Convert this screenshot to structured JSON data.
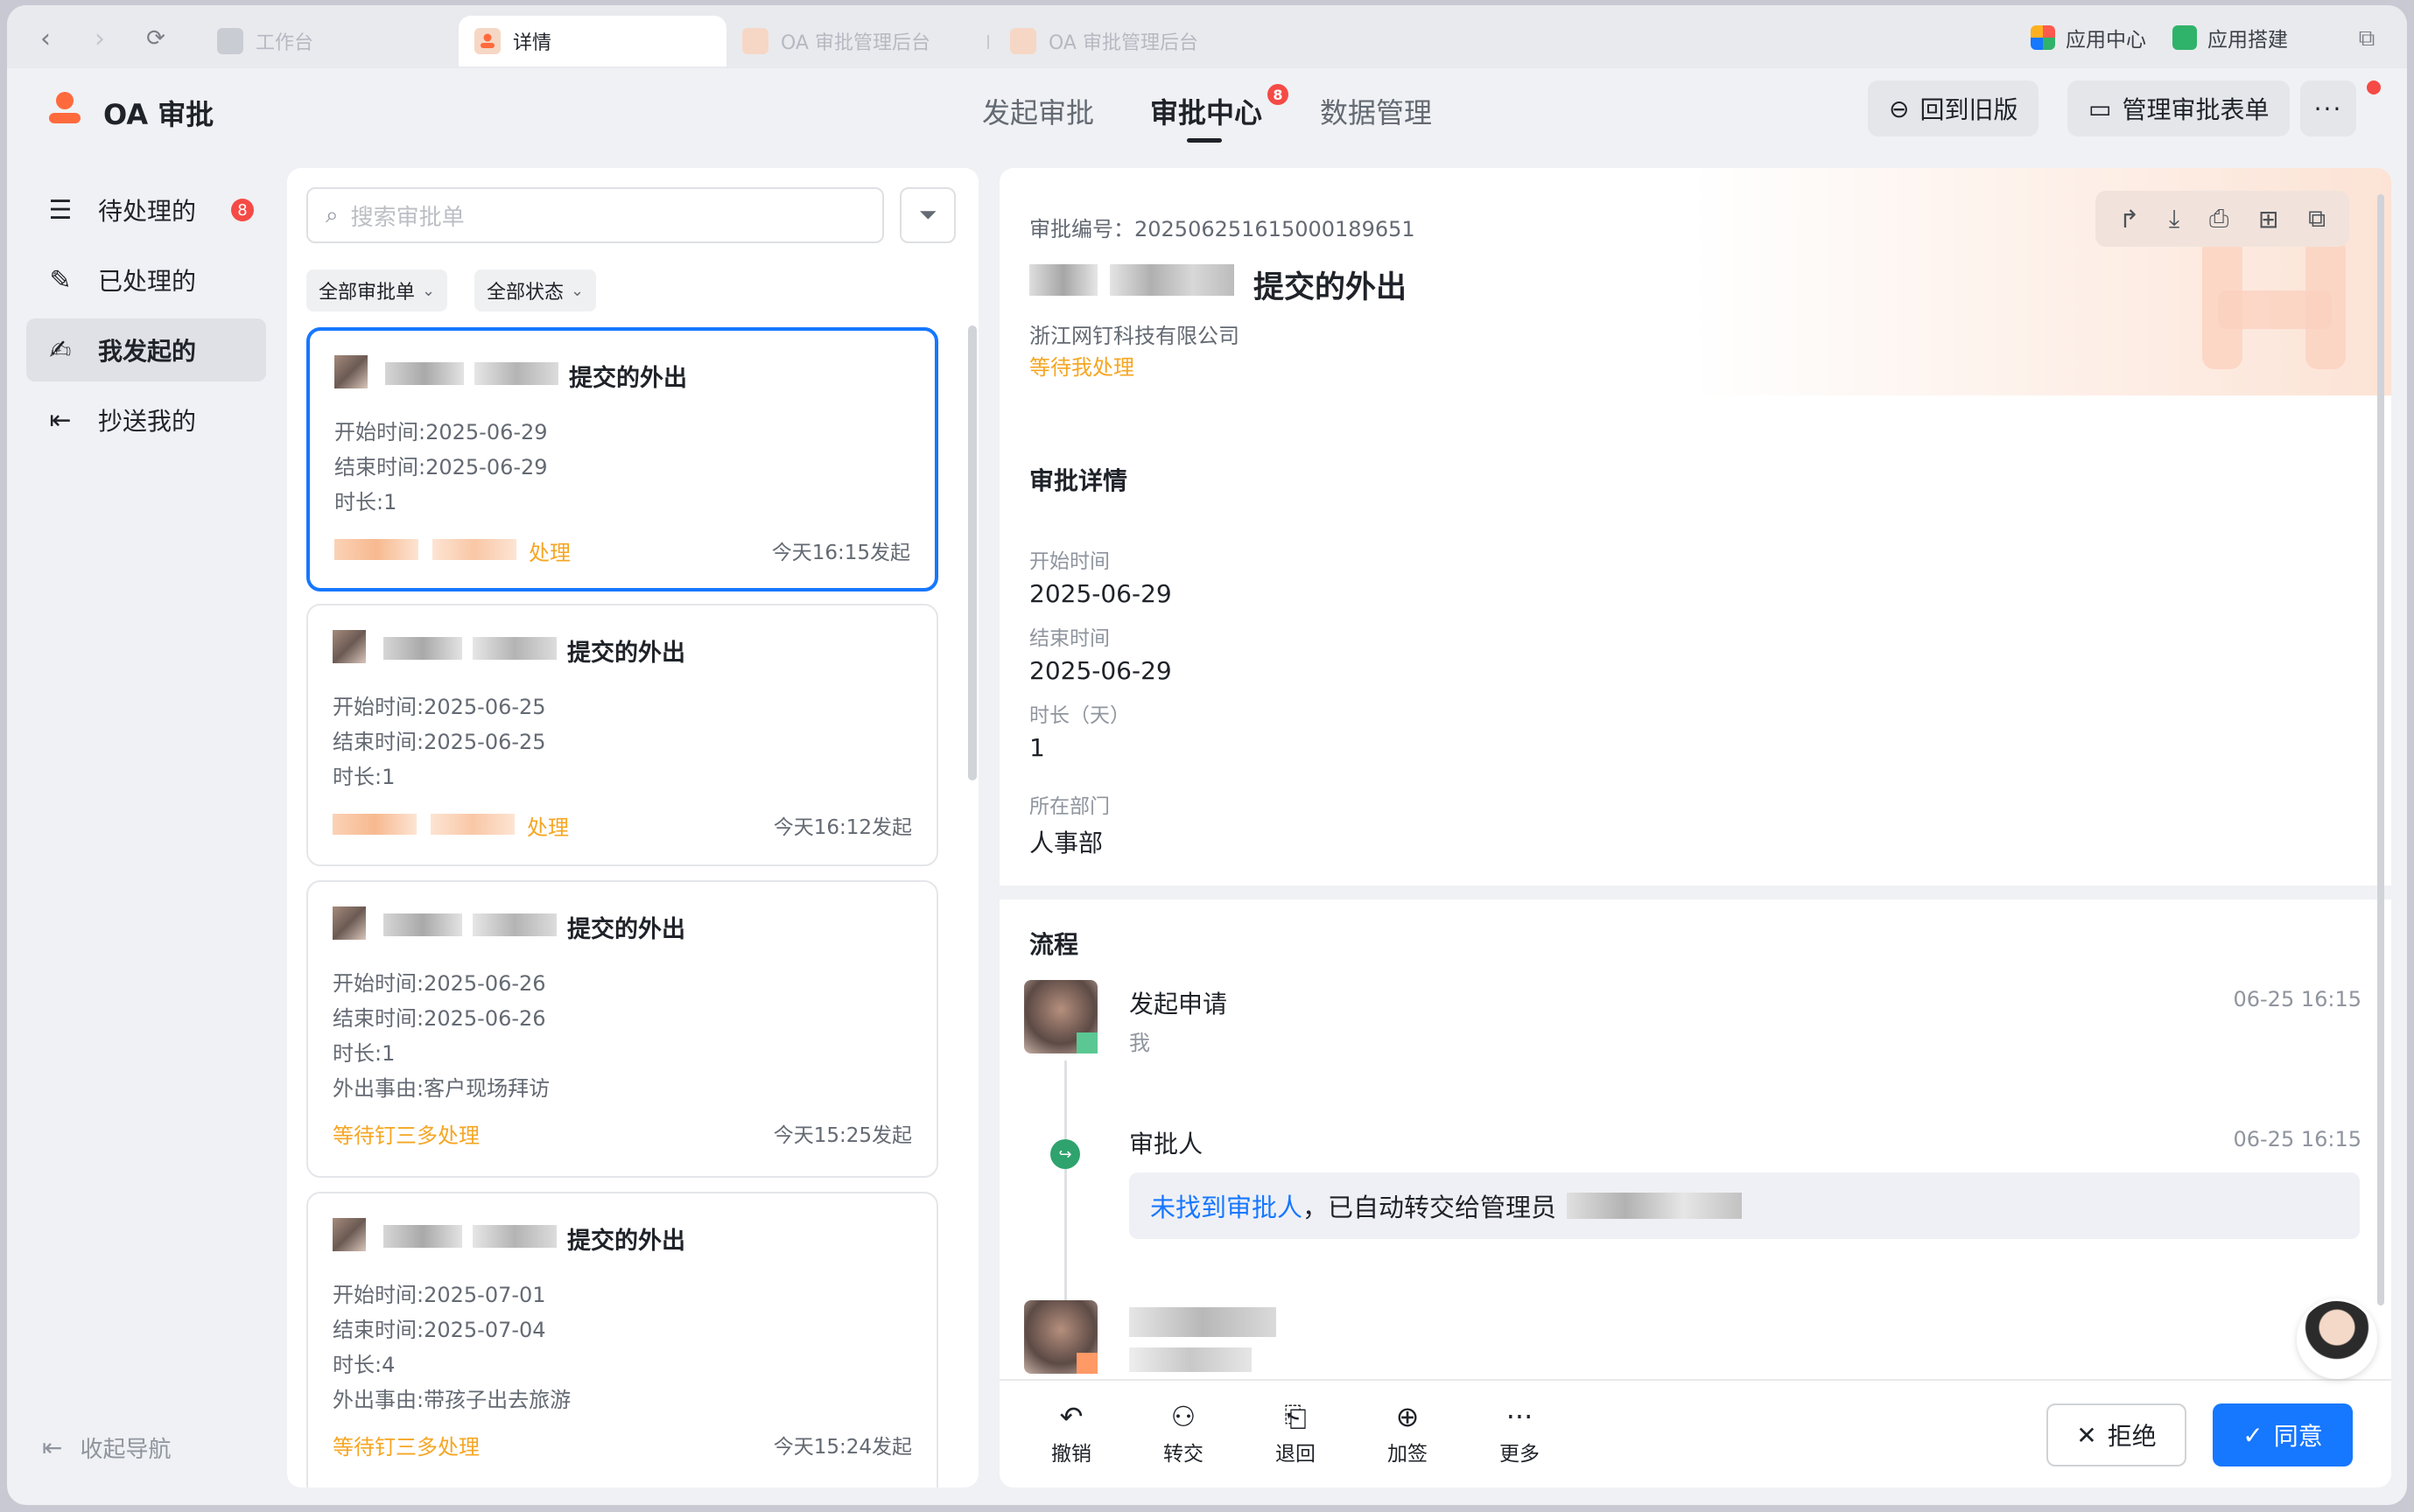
{
  "tabs": [
    {
      "label": "工作台",
      "active": false
    },
    {
      "label": "详情",
      "active": true
    },
    {
      "label": "OA 审批管理后台",
      "active": false
    },
    {
      "label": "OA 审批管理后台",
      "active": false
    }
  ],
  "tabbar_right": {
    "app_center": "应用中心",
    "app_build": "应用搭建"
  },
  "app": {
    "title": "OA 审批"
  },
  "topnav": [
    {
      "label": "发起审批",
      "active": false
    },
    {
      "label": "审批中心",
      "active": true,
      "badge": "8"
    },
    {
      "label": "数据管理",
      "active": false
    }
  ],
  "header_buttons": {
    "back_old": "回到旧版",
    "manage_forms": "管理审批表单",
    "more": "···"
  },
  "sidebar": {
    "items": [
      {
        "label": "待处理的",
        "badge": "8",
        "icon": "pending-list-icon"
      },
      {
        "label": "已处理的",
        "icon": "processed-icon"
      },
      {
        "label": "我发起的",
        "icon": "initiated-icon",
        "active": true
      },
      {
        "label": "抄送我的",
        "icon": "cc-icon"
      }
    ],
    "collapse": "收起导航"
  },
  "list": {
    "search_placeholder": "搜索审批单",
    "filter_all_forms": "全部审批单",
    "filter_all_status": "全部状态",
    "cards": [
      {
        "title": "提交的外出",
        "start": "开始时间:2025-06-29",
        "end": "结束时间:2025-06-29",
        "duration": "时长:1",
        "reason": "",
        "status": "处理",
        "time": "今天16:15发起",
        "selected": true
      },
      {
        "title": "提交的外出",
        "start": "开始时间:2025-06-25",
        "end": "结束时间:2025-06-25",
        "duration": "时长:1",
        "reason": "",
        "status": "处理",
        "time": "今天16:12发起"
      },
      {
        "title": "提交的外出",
        "start": "开始时间:2025-06-26",
        "end": "结束时间:2025-06-26",
        "duration": "时长:1",
        "reason": "外出事由:客户现场拜访",
        "status": "等待钉三多处理",
        "time": "今天15:25发起"
      },
      {
        "title": "提交的外出",
        "start": "开始时间:2025-07-01",
        "end": "结束时间:2025-07-04",
        "duration": "时长:4",
        "reason": "外出事由:带孩子出去旅游",
        "status": "等待钉三多处理",
        "time": "今天15:24发起"
      }
    ]
  },
  "detail": {
    "id": "审批编号：202506251615000189651",
    "title": "提交的外出",
    "company": "浙江网钉科技有限公司",
    "status": "等待我处理",
    "section_title": "审批详情",
    "fields": [
      {
        "label": "开始时间",
        "value": "2025-06-29"
      },
      {
        "label": "结束时间",
        "value": "2025-06-29"
      },
      {
        "label": "时长（天）",
        "value": "1"
      },
      {
        "label": "所在部门",
        "value": "人事部"
      }
    ],
    "flow_title": "流程",
    "flow": [
      {
        "name": "发起申请",
        "sub": "我",
        "time": "06-25 16:15"
      },
      {
        "name": "审批人",
        "time": "06-25 16:15",
        "note_link": "未找到审批人",
        "note_rest": "，已自动转交给管理员"
      }
    ],
    "actions": [
      "撤销",
      "转交",
      "退回",
      "加签",
      "更多"
    ],
    "reject": "拒绝",
    "agree": "同意"
  },
  "colors": {
    "accent": "#1677ff",
    "warning": "#f5a623",
    "badge": "#f54a45",
    "brand": "#ff6a3d"
  }
}
